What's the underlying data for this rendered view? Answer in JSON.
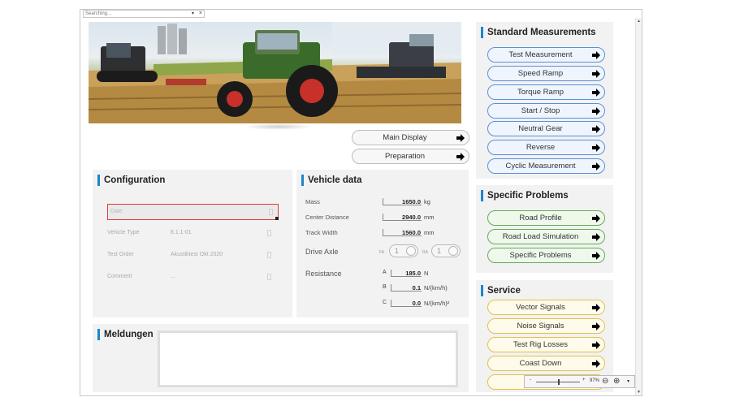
{
  "search": {
    "placeholder": "Searching..."
  },
  "hero": {
    "image_icon": "agricultural-machinery-banner"
  },
  "main_buttons": [
    {
      "label": "Main Display"
    },
    {
      "label": "Preparation"
    }
  ],
  "configuration": {
    "title": "Configuration",
    "date_label": "Date",
    "rows": [
      {
        "label": "Vehicle Type",
        "value": "8.1.1-01"
      },
      {
        "label": "Test Order",
        "value": "Akustiktest Okt 2020"
      },
      {
        "label": "Comment",
        "value": "..."
      }
    ]
  },
  "vehicle_data": {
    "title": "Vehicle data",
    "mass": {
      "label": "Mass",
      "value": "1650.0",
      "unit": "kg"
    },
    "center_distance": {
      "label": "Center Distance",
      "value": "2940.0",
      "unit": "mm"
    },
    "track_width": {
      "label": "Track Width",
      "value": "1560.0",
      "unit": "mm"
    },
    "drive_axle": {
      "label": "Drive Axle",
      "fa_label": "FA",
      "fa_value": "1",
      "ra_label": "RA",
      "ra_value": "1"
    },
    "resistance": {
      "label": "Resistance",
      "a": {
        "label": "A",
        "value": "185.0",
        "unit": "N"
      },
      "b": {
        "label": "B",
        "value": "0.1",
        "unit": "N/(km/h)"
      },
      "c": {
        "label": "C",
        "value": "0.0",
        "unit": "N/(km/h)²"
      }
    }
  },
  "meldungen": {
    "title": "Meldungen"
  },
  "standard_measurements": {
    "title": "Standard Measurements",
    "items": [
      {
        "label": "Test Measurement"
      },
      {
        "label": "Speed Ramp"
      },
      {
        "label": "Torque Ramp"
      },
      {
        "label": "Start / Stop"
      },
      {
        "label": "Neutral Gear"
      },
      {
        "label": "Reverse"
      },
      {
        "label": "Cyclic Measurement"
      }
    ]
  },
  "specific_problems": {
    "title": "Specific Problems",
    "items": [
      {
        "label": "Road Profile"
      },
      {
        "label": "Road Load Simulation"
      },
      {
        "label": "Specific Problems"
      }
    ]
  },
  "service": {
    "title": "Service",
    "items": [
      {
        "label": "Vector Signals"
      },
      {
        "label": "Noise Signals"
      },
      {
        "label": "Test Rig Losses"
      },
      {
        "label": "Coast Down"
      },
      {
        "label": ""
      }
    ]
  },
  "zoom": {
    "minus": "-",
    "plus": "+",
    "level": "97%",
    "zoom_level_fraction": 0.5
  },
  "colors": {
    "accent": "#1c86c8",
    "blue_border": "#5b8fd8",
    "green_border": "#66aa55",
    "yellow_border": "#e0c24a",
    "error": "#e23a3a"
  }
}
